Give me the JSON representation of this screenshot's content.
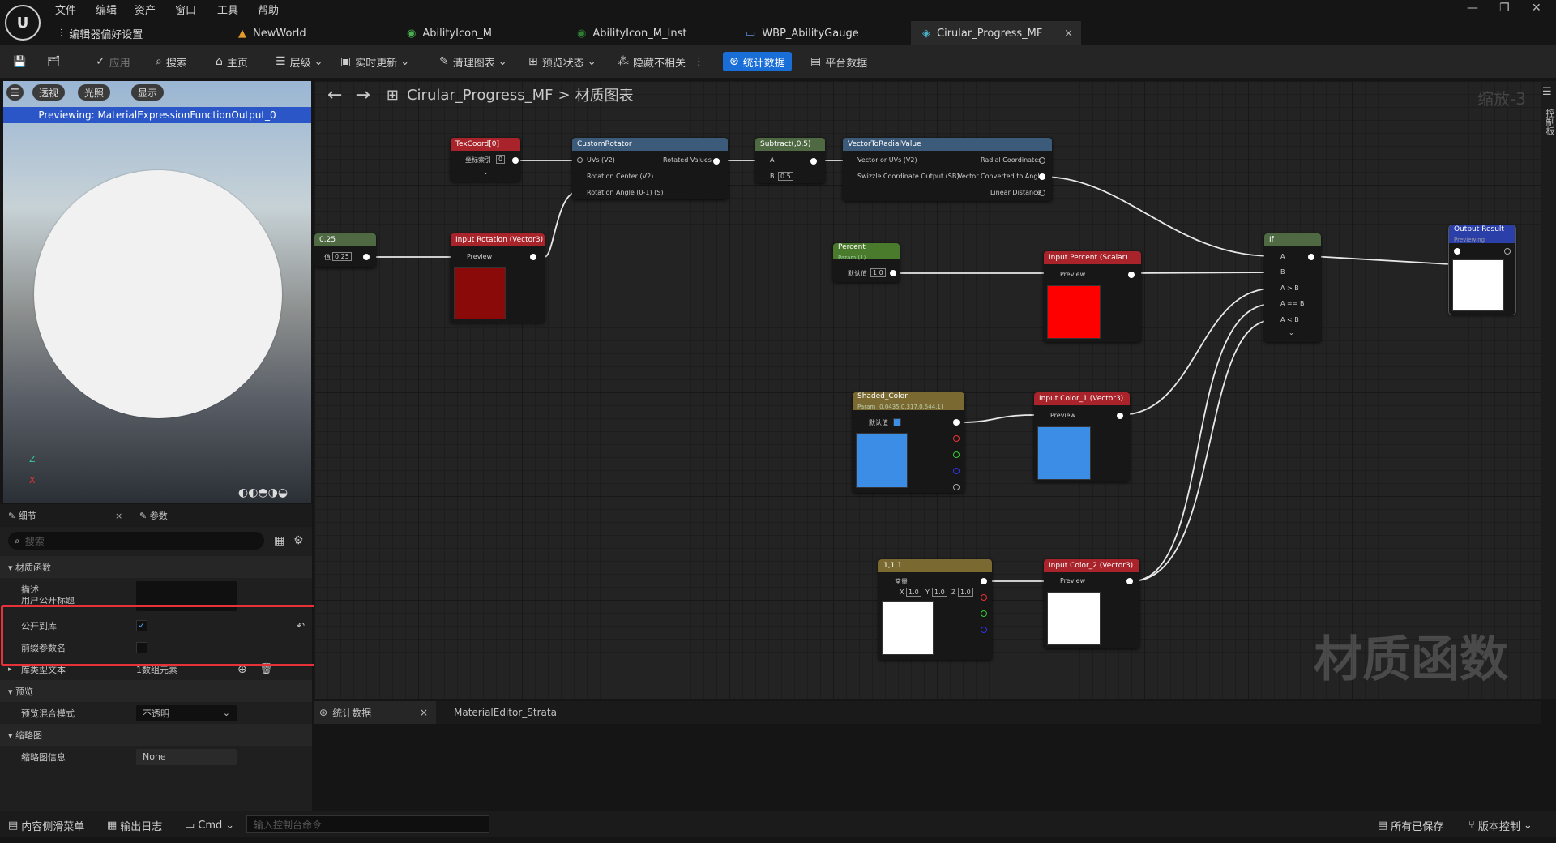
{
  "menu": [
    "文件",
    "编辑",
    "资产",
    "窗口",
    "工具",
    "帮助"
  ],
  "tabs": [
    {
      "label": "编辑器偏好设置"
    },
    {
      "label": "NewWorld"
    },
    {
      "label": "AbilityIcon_M"
    },
    {
      "label": "AbilityIcon_M_Inst"
    },
    {
      "label": "WBP_AbilityGauge"
    },
    {
      "label": "Cirular_Progress_MF"
    }
  ],
  "tab_close": "×",
  "window_controls": {
    "minimize": "—",
    "restore": "❐",
    "close": "✕"
  },
  "toolbar": {
    "apply": "应用",
    "search": "搜索",
    "home": "主页",
    "hierarchy": "层级",
    "live_update": "实时更新",
    "clean_graph": "清理图表",
    "preview_state": "预览状态",
    "hide_unrelated": "隐藏不相关",
    "stats": "统计数据",
    "platform_stats": "平台数据"
  },
  "viewport": {
    "btn_perspective": "透视",
    "btn_lit": "光照",
    "btn_show": "显示",
    "banner": "Previewing: MaterialExpressionFunctionOutput_0",
    "axis_z": "Z",
    "axis_x": "X"
  },
  "details": {
    "tab_details": "细节",
    "tab_params": "参数",
    "search_placeholder": "搜索",
    "category_material_function": "材质函数",
    "rows": [
      {
        "label": "描述",
        "value": ""
      },
      {
        "label": "用户公开标题",
        "value": ""
      },
      {
        "label": "公开到库",
        "checked": true
      },
      {
        "label": "前缀参数名",
        "checked": false
      },
      {
        "label": "库类型文本",
        "value": "1数组元素"
      }
    ],
    "category_preview": "预览",
    "preview_blend_label": "预览混合模式",
    "preview_blend_value": "不透明",
    "category_thumbnail": "缩略图",
    "thumbnail_info_label": "缩略图信息",
    "thumbnail_info_value": "None"
  },
  "graph": {
    "breadcrumb_asset": "Cirular_Progress_MF",
    "breadcrumb_sep": ">",
    "breadcrumb_view": "材质图表",
    "zoom": "缩放-3",
    "watermark": "材质函数",
    "nodes": {
      "texcoord": {
        "title": "TexCoord[0]",
        "pin": "坐标索引",
        "value": "0"
      },
      "custom_rotator": {
        "title": "CustomRotator",
        "in1": "UVs (V2)",
        "in2": "Rotation Center (V2)",
        "in3": "Rotation Angle (0-1) (S)",
        "out": "Rotated Values"
      },
      "subtract": {
        "title": "Subtract(,0.5)",
        "in_a": "A",
        "in_b": "B",
        "b_value": "0.5"
      },
      "vec_radial": {
        "title": "VectorToRadialValue",
        "in1": "Vector or UVs (V2)",
        "in2": "Swizzle Coordinate Output (SB)",
        "out1": "Radial Coordinates",
        "out2": "Vector Converted to Angle",
        "out3": "Linear Distance"
      },
      "const_025": {
        "title": "0.25",
        "pin": "值",
        "value": "0.25"
      },
      "input_rotation": {
        "title": "Input Rotation (Vector3)",
        "pin": "Preview",
        "color": "#8a0a0a"
      },
      "percent": {
        "title": "Percent",
        "sub": "Param (1)",
        "pin": "默认值",
        "value": "1.0"
      },
      "input_percent": {
        "title": "Input Percent (Scalar)",
        "pin": "Preview",
        "color": "#ff0000"
      },
      "if": {
        "title": "If",
        "pins": [
          "A",
          "B",
          "A > B",
          "A == B",
          "A < B"
        ]
      },
      "output": {
        "title": "Output Result",
        "sub": "Previewing",
        "color": "#ffffff"
      },
      "shaded_color": {
        "title": "Shaded_Color",
        "sub": "Param (0.0435,0.317,0.544,1)",
        "pin": "默认值",
        "color": "#3b8de6"
      },
      "input_color1": {
        "title": "Input Color_1 (Vector3)",
        "pin": "Preview",
        "color": "#3b8de6"
      },
      "const_111": {
        "title": "1,1,1",
        "pin": "常量",
        "x": "1.0",
        "y": "1.0",
        "z": "1.0",
        "lx": "X",
        "ly": "Y",
        "lz": "Z",
        "color": "#ffffff"
      },
      "input_color2": {
        "title": "Input Color_2 (Vector3)",
        "pin": "Preview",
        "color": "#ffffff"
      }
    }
  },
  "bottom_tabs": {
    "stats": "统计数据",
    "strata": "MaterialEditor_Strata"
  },
  "right_strip": "控制板",
  "statusbar": {
    "content_drawer": "内容侧滑菜单",
    "output_log": "输出日志",
    "cmd": "Cmd",
    "cmd_placeholder": "输入控制台命令",
    "saved": "所有已保存",
    "version_control": "版本控制"
  }
}
